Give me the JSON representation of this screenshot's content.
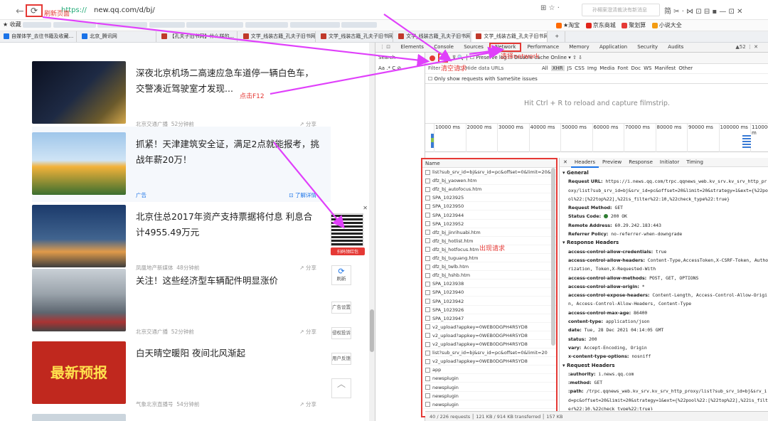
{
  "browser": {
    "url_scheme": "https://",
    "url": "new.qq.com/d/bj/",
    "addr_right": "⊞ ☆ ·",
    "search_placeholder": "孙楊案澄清裁決有新消息",
    "tools": "简 ✂ · ⋈ ⊡ ⊟ ▪ — ⊡ ✕",
    "bookmarks_label": "收藏",
    "bookmarks_right": [
      "★淘宝",
      "京东商城",
      "聚划算",
      "小说大全"
    ],
    "tabs": [
      "自媒体学_去往书籍及收藏...",
      "北京_腾讯网",
      "【孔夫子旧书网】什么样的...",
      "文学_线装古籍_孔夫子旧书网",
      "文学_线装古籍_孔夫子旧书网",
      "文学_线装古籍_孔夫子旧书网",
      "文学_线装古籍_孔夫子旧书网",
      "+"
    ]
  },
  "news": [
    {
      "title": "深夜北京机场二高速应急车道停一辆白色车，交警凑近驾驶室才发现...",
      "source": "北京交通广播",
      "time": "52分钟前",
      "share": "分享"
    },
    {
      "title": "抓紧！天津建筑安全证，满足2点就能报考，挑战年薪20万！",
      "source": "广告",
      "time": "",
      "share": "了解详情"
    },
    {
      "title": "北京住总2017年资产支持票据将付息 利息合计4955.49万元",
      "source": "凤凰地产新媒体",
      "time": "48分钟前",
      "share": "分享"
    },
    {
      "title": "关注！这些经济型车辆配件明显涨价",
      "source": "北京交通广播",
      "time": "52分钟前",
      "share": "分享"
    },
    {
      "title": "白天晴空暖阳 夜间北风渐起",
      "source": "气象北京直播号",
      "time": "54分钟前",
      "share": "分享"
    }
  ],
  "thumb_text": "最新预报",
  "sidebar": {
    "qr_label": "扫码领红包",
    "refresh": "刷新",
    "ad_settings": "广告设置",
    "report": "侵权投诉",
    "feedback": "用户反馈"
  },
  "devtools": {
    "tabs": [
      "Elements",
      "Console",
      "Sources",
      "Network",
      "Performance",
      "Memory",
      "Application",
      "Security",
      "Audits"
    ],
    "warn": "▲52 ⋮ ✕",
    "search_label": "Search",
    "search_opts": "Aa .* C ⊘",
    "toolbar": "⊽ 🔍 │ ☐ Preserve log  ☐ Disable cache  Online ▾  ⇧ ⇩",
    "filter": "Filter",
    "hide_data": "☐ Hide data URLs",
    "types": [
      "All",
      "XHR",
      "JS",
      "CSS",
      "Img",
      "Media",
      "Font",
      "Doc",
      "WS",
      "Manifest",
      "Other"
    ],
    "samesite": "☐ Only show requests with SameSite issues",
    "hint": "Hit Ctrl + R to reload and capture filmstrip.",
    "ticks": [
      "10000 ms",
      "20000 ms",
      "30000 ms",
      "40000 ms",
      "50000 ms",
      "60000 ms",
      "70000 ms",
      "80000 ms",
      "90000 ms",
      "100000 ms",
      "110000 m"
    ],
    "name_header": "Name",
    "requests": [
      "list?sub_srv_id=bj&srv_id=pc&offset=0&limit=20&st",
      "dfz_bj_yaowen.htm",
      "dfz_bj_autofocus.htm",
      "SPA_1023925",
      "SPA_1023950",
      "SPA_1023944",
      "SPA_1023952",
      "dfz_bj_jinrihuabi.htm",
      "dfz_bj_hotlist.htm",
      "dfz_bj_hotfocus.htm",
      "dfz_bj_tuguang.htm",
      "dfz_bj_twlb.htm",
      "dfz_bj_hshb.htm",
      "SPA_1023938",
      "SPA_1023940",
      "SPA_1023942",
      "SPA_1023926",
      "SPA_1023947",
      "v2_upload?appkey=0WEB0DGPH4R5YD8",
      "v2_upload?appkey=0WEB0DGPH4R5YD8",
      "v2_upload?appkey=0WEB0DGPH4R5YD8",
      "list?sub_srv_id=bj&srv_id=pc&offset=0&limit=20",
      "v2_upload?appkey=0WEB0DGPH4R5YD8",
      "app",
      "newsplugin",
      "newsplugin",
      "newsplugin",
      "newsplugin"
    ],
    "status": "40 / 226 requests  │  121 KB / 914 KB transferred  │  157 KB",
    "detail_tabs": [
      "✕",
      "Headers",
      "Preview",
      "Response",
      "Initiator",
      "Timing"
    ],
    "general": "General",
    "req_url_k": "Request URL:",
    "req_url_v": "https://i.news.qq.com/trpc.qqnews_web.kv_srv.kv_srv_http_proxy/list?sub_srv_id=bj&srv_id=pc&offset=20&limit=20&strategy=1&ext={%22pool%22:[%22top%22],%22is_filter%22:10,%22check_type%22:true}",
    "req_method_k": "Request Method:",
    "req_method_v": "GET",
    "status_k": "Status Code:",
    "status_v": "200 OK",
    "remote_k": "Remote Address:",
    "remote_v": "60.29.242.183:443",
    "referrer_k": "Referrer Policy:",
    "referrer_v": "no-referrer-when-downgrade",
    "resp_headers": "Response Headers",
    "resp": [
      [
        "access-control-allow-credentials:",
        "true"
      ],
      [
        "access-control-allow-headers:",
        "Content-Type,AccessToken,X-CSRF-Token, Authorization, Token,X-Requested-With"
      ],
      [
        "access-control-allow-methods:",
        "POST, GET, OPTIONS"
      ],
      [
        "access-control-allow-origin:",
        "*"
      ],
      [
        "access-control-expose-headers:",
        "Content-Length, Access-Control-Allow-Origin, Access-Control-Allow-Headers, Content-Type"
      ],
      [
        "access-control-max-age:",
        "86400"
      ],
      [
        "content-type:",
        "application/json"
      ],
      [
        "date:",
        "Tue, 28 Dec 2021 04:14:05 GMT"
      ],
      [
        "status:",
        "200"
      ],
      [
        "vary:",
        "Accept-Encoding, Origin"
      ],
      [
        "x-content-type-options:",
        "nosniff"
      ]
    ],
    "req_headers": "Request Headers",
    "req": [
      [
        ":authority:",
        "i.news.qq.com"
      ],
      [
        ":method:",
        "GET"
      ],
      [
        ":path:",
        "/trpc.qqnews_web.kv_srv.kv_srv_http_proxy/list?sub_srv_id=bj&srv_id=pc&offset=20&limit=20&strategy=1&ext={%22pool%22:[%22top%22],%22is_filter%22:10,%22check_type%22:true}"
      ]
    ]
  },
  "annotations": {
    "refresh": "刷新页面",
    "f12": "点击F12",
    "network": "选择network",
    "clear": "清空请求",
    "requests": "出现请求"
  }
}
